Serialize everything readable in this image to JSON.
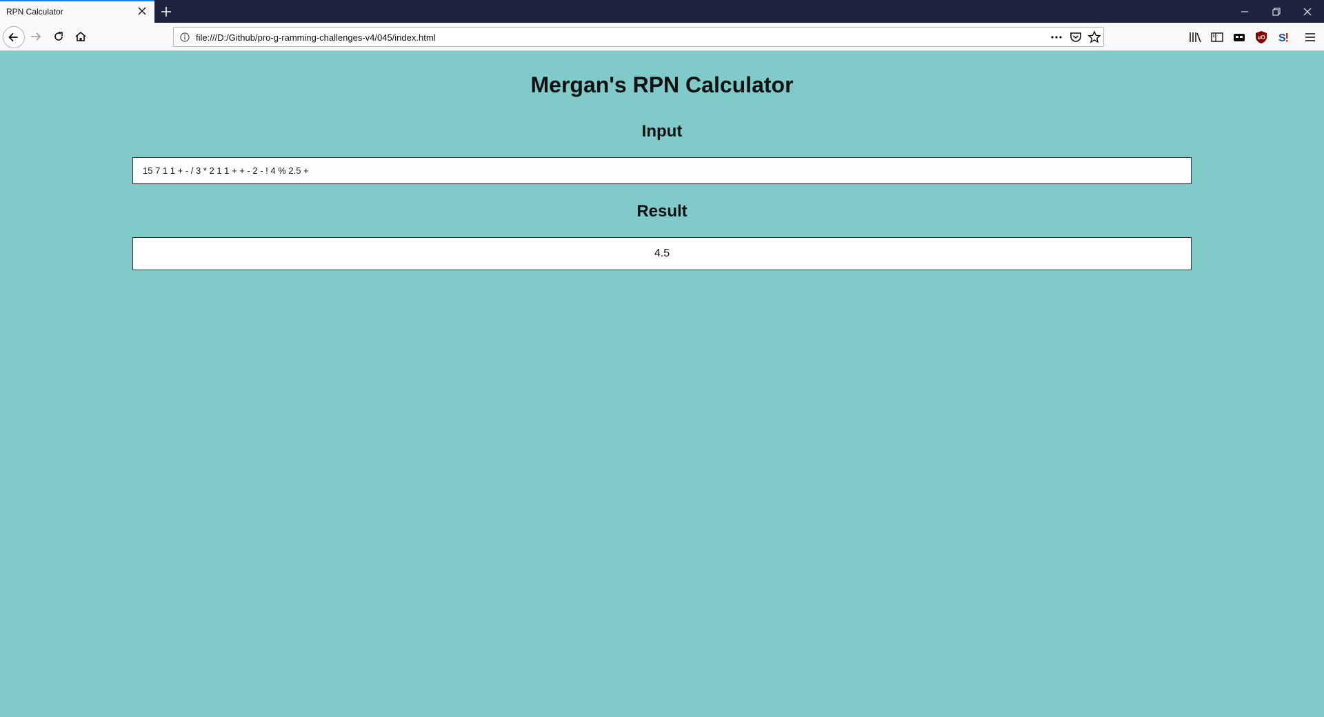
{
  "browser": {
    "tab_title": "RPN Calculator",
    "url": "file:///D:/Github/pro-g-ramming-challenges-v4/045/index.html"
  },
  "page": {
    "title": "Mergan's RPN Calculator",
    "input_heading": "Input",
    "input_value": "15 7 1 1 + - / 3 * 2 1 1 + + - 2 - ! 4 % 2.5 +",
    "result_heading": "Result",
    "result_value": "4.5"
  },
  "colors": {
    "page_background": "#80caca",
    "tabbar_background": "#202340",
    "tab_accent": "#0a84ff"
  },
  "icons": [
    "close-icon",
    "plus-icon",
    "minimize-icon",
    "restore-icon",
    "window-close-icon",
    "back-arrow-icon",
    "forward-arrow-icon",
    "reload-icon",
    "home-icon",
    "info-icon",
    "more-icon",
    "pocket-icon",
    "bookmark-star-icon",
    "library-icon",
    "sidebar-icon",
    "container-icon",
    "ublock-icon",
    "extension-icon",
    "hamburger-menu-icon"
  ]
}
